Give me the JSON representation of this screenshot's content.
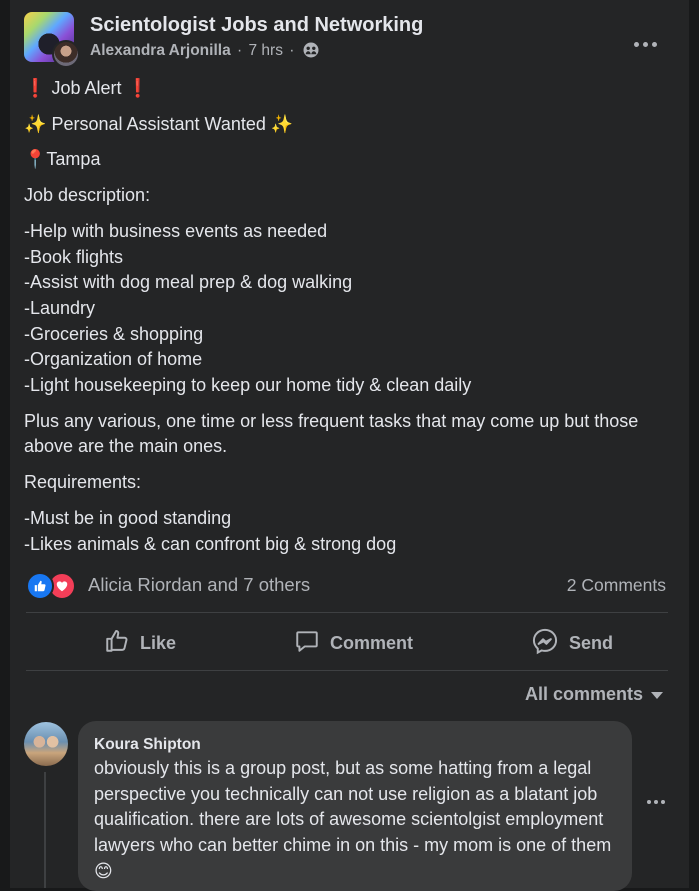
{
  "colors": {
    "background": "#18191a",
    "card": "#242526",
    "text_primary": "#e4e6eb",
    "text_secondary": "#b0b3b8",
    "like_blue": "#1877f2",
    "love_red": "#f33e58",
    "comment_bubble": "#3a3b3c"
  },
  "post": {
    "group_name": "Scientologist Jobs and Networking",
    "author": "Alexandra Arjonilla",
    "time": "7 hrs",
    "audience_icon": "group-members-icon",
    "more_icon": "more-options-icon",
    "lines": {
      "job_alert_emoji": "❗",
      "job_alert_text": "Job Alert",
      "sparkle_emoji": "✨",
      "personal_assistant_text": "Personal Assistant Wanted",
      "pin_emoji": "📍",
      "location": "Tampa",
      "job_description_heading": "Job description:",
      "duties": [
        "-Help with business events as needed",
        "-Book flights",
        "-Assist with dog meal prep & dog walking",
        "-Laundry",
        "-Groceries & shopping",
        "-Organization of home",
        "-Light housekeeping to keep our home tidy & clean daily"
      ],
      "other_tasks": "Plus any various, one time or less frequent tasks that may come up but those above are the main ones.",
      "requirements_heading": "Requirements:",
      "requirements": [
        "-Must be in good standing",
        "-Likes animals & can confront big & strong dog"
      ]
    }
  },
  "reactions": {
    "icons": [
      "like-reaction-icon",
      "love-reaction-icon"
    ],
    "names": "Alicia Riordan and 7 others",
    "comments_count": "2 Comments"
  },
  "actions": {
    "like": "Like",
    "comment": "Comment",
    "send": "Send"
  },
  "comments_filter": "All comments",
  "comment": {
    "author": "Koura Shipton",
    "text": "obviously this is a group post, but as some hatting from a legal perspective you technically can not use religion as a blatant job qualification. there are lots of awesome scientolgist employment lawyers who can better chime in on this - my mom is one of them",
    "emoji": "😊"
  }
}
